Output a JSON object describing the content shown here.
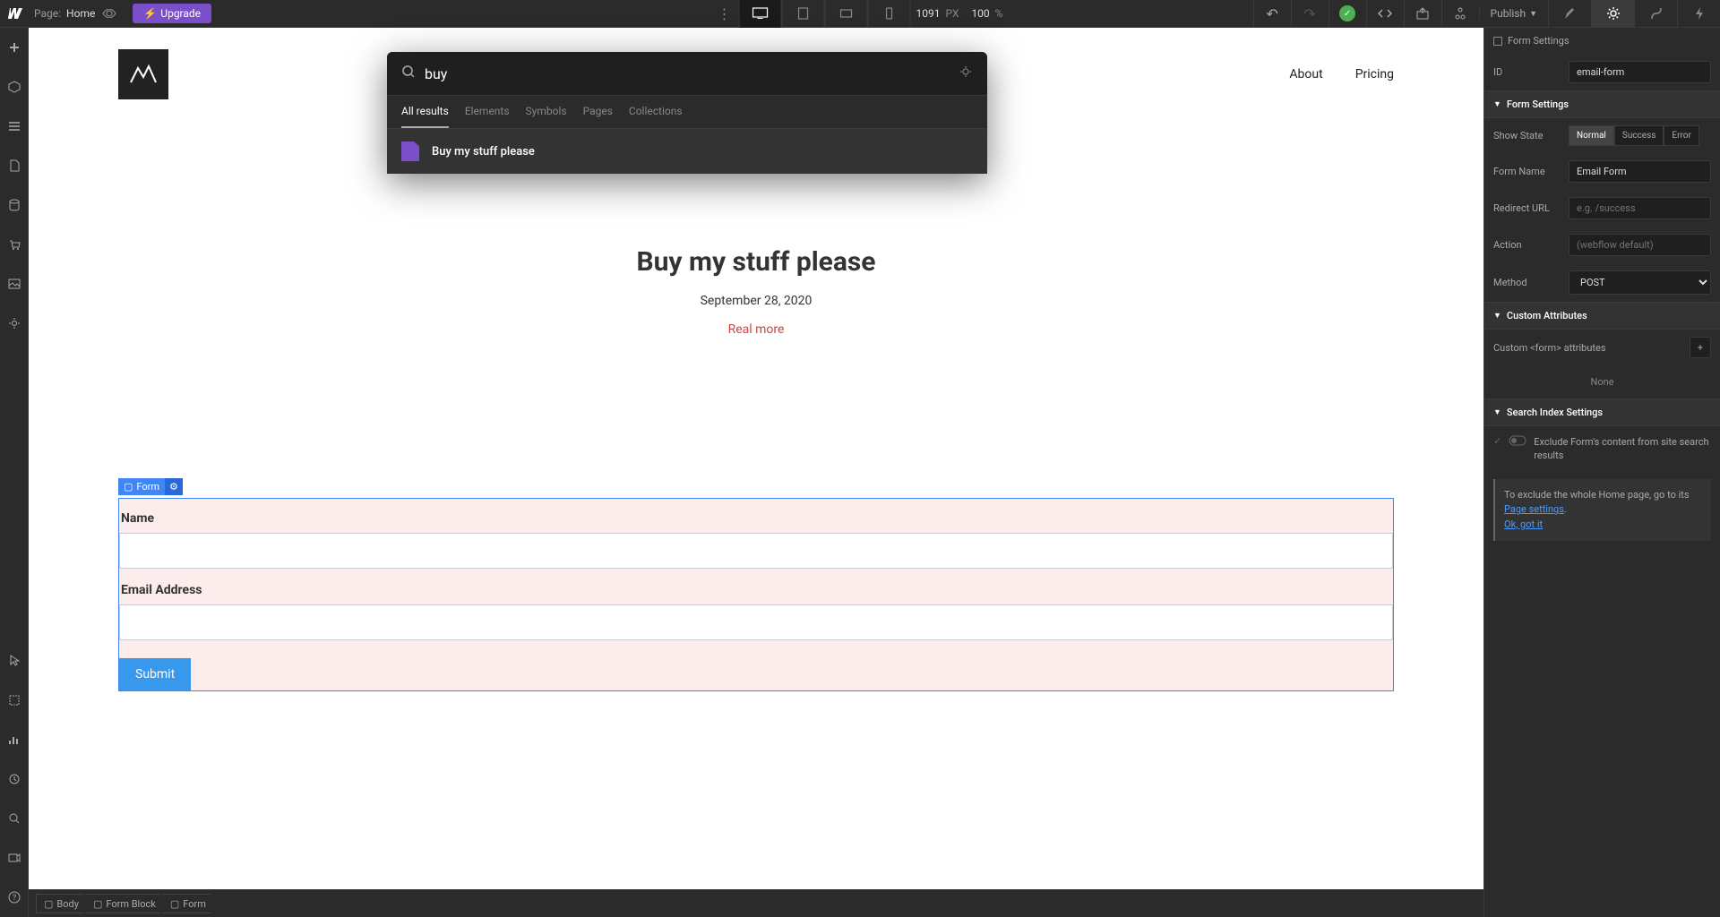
{
  "topbar": {
    "page_label": "Page:",
    "page_name": "Home",
    "upgrade": "Upgrade",
    "width": "1091",
    "width_unit": "PX",
    "zoom": "100",
    "zoom_unit": "%",
    "publish": "Publish"
  },
  "nav": {
    "about": "About",
    "pricing": "Pricing"
  },
  "hero": {
    "title": "Buy my stuff please",
    "date": "September 28, 2020",
    "read_more": "Real more"
  },
  "form": {
    "tag": "Form",
    "name_label": "Name",
    "email_label": "Email Address",
    "submit": "Submit"
  },
  "search": {
    "query": "buy",
    "tabs": {
      "all": "All results",
      "elements": "Elements",
      "symbols": "Symbols",
      "pages": "Pages",
      "collections": "Collections"
    },
    "result": "Buy my stuff please"
  },
  "panel": {
    "form_settings_header": "Form Settings",
    "id_label": "ID",
    "id_value": "email-form",
    "section_form": "Form Settings",
    "show_state": "Show State",
    "state_normal": "Normal",
    "state_success": "Success",
    "state_error": "Error",
    "form_name_label": "Form Name",
    "form_name_value": "Email Form",
    "redirect_label": "Redirect URL",
    "redirect_placeholder": "e.g. /success",
    "action_label": "Action",
    "action_placeholder": "(webflow default)",
    "method_label": "Method",
    "method_value": "POST",
    "section_custom": "Custom Attributes",
    "custom_attr_label": "Custom <form> attributes",
    "none": "None",
    "section_search": "Search Index Settings",
    "exclude_text": "Exclude Form's content from site search results",
    "info_text_1": "To exclude the whole Home page, go to its ",
    "info_link": "Page settings",
    "info_dot": ".",
    "ok_got_it": "Ok, got it"
  },
  "breadcrumb": {
    "body": "Body",
    "form_block": "Form Block",
    "form": "Form"
  }
}
